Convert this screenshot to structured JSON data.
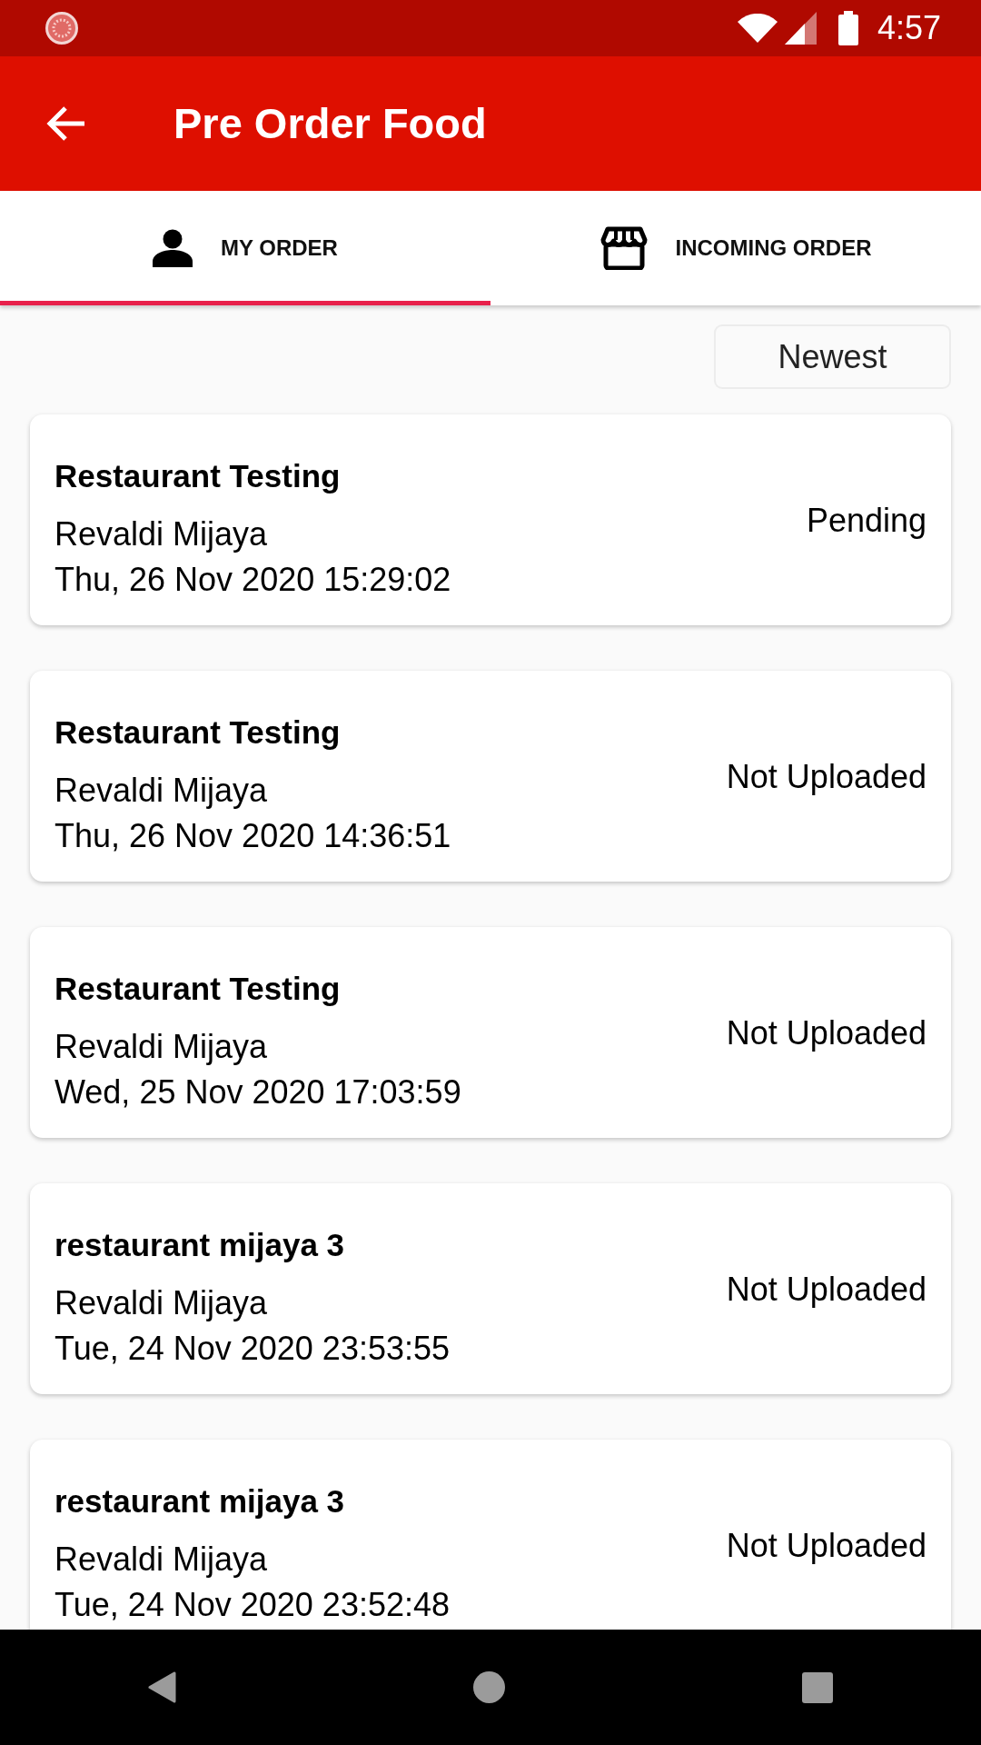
{
  "status_bar": {
    "time": "4:57"
  },
  "app_bar": {
    "title": "Pre Order Food"
  },
  "tabs": [
    {
      "label": "MY ORDER",
      "selected": true
    },
    {
      "label": "INCOMING ORDER",
      "selected": false
    }
  ],
  "sort_button": {
    "label": "Newest"
  },
  "orders": [
    {
      "restaurant": "Restaurant Testing",
      "customer": "Revaldi Mijaya",
      "date": "Thu, 26 Nov 2020 15:29:02",
      "status": "Pending"
    },
    {
      "restaurant": "Restaurant Testing",
      "customer": "Revaldi Mijaya",
      "date": "Thu, 26 Nov 2020 14:36:51",
      "status": "Not Uploaded"
    },
    {
      "restaurant": "Restaurant Testing",
      "customer": "Revaldi Mijaya",
      "date": "Wed, 25 Nov 2020 17:03:59",
      "status": "Not Uploaded"
    },
    {
      "restaurant": "restaurant mijaya 3",
      "customer": "Revaldi Mijaya",
      "date": "Tue, 24 Nov 2020 23:53:55",
      "status": "Not Uploaded"
    },
    {
      "restaurant": "restaurant mijaya 3",
      "customer": "Revaldi Mijaya",
      "date": "Tue, 24 Nov 2020 23:52:48",
      "status": "Not Uploaded"
    }
  ]
}
